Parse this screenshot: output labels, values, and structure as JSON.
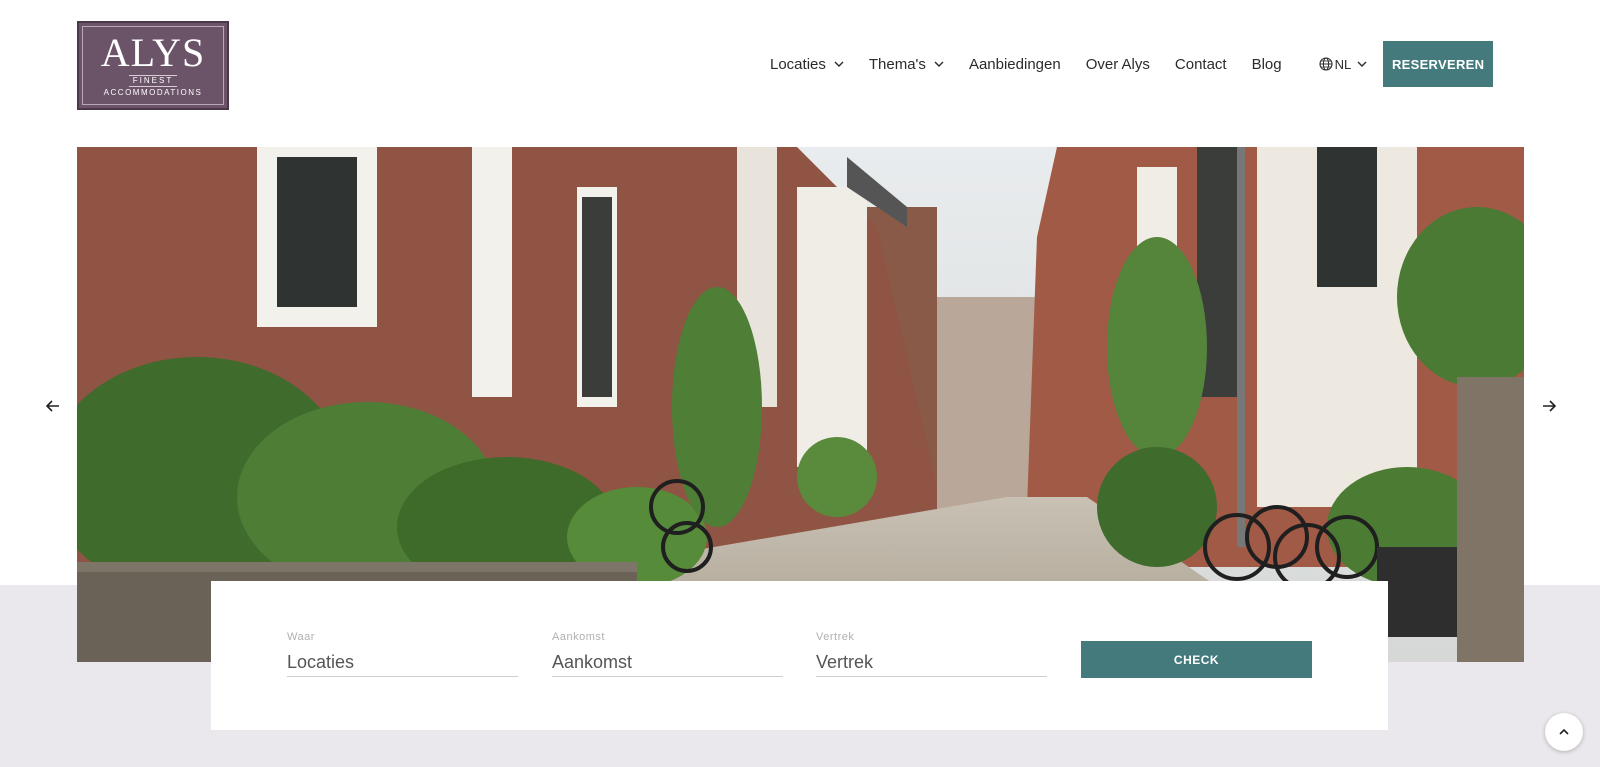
{
  "brand": {
    "name": "ALYS",
    "tagline_1": "FINEST",
    "tagline_2": "ACCOMMODATIONS",
    "color": "#6b5468"
  },
  "nav": {
    "items": [
      {
        "label": "Locaties",
        "has_dropdown": true
      },
      {
        "label": "Thema's",
        "has_dropdown": true
      },
      {
        "label": "Aanbiedingen",
        "has_dropdown": false
      },
      {
        "label": "Over Alys",
        "has_dropdown": false
      },
      {
        "label": "Contact",
        "has_dropdown": false
      },
      {
        "label": "Blog",
        "has_dropdown": false
      }
    ],
    "language": "NL",
    "reserve_label": "RESERVEREN"
  },
  "hero": {
    "image": "Street photo: narrow cobblestone alley between brick houses with plants and bicycles",
    "prev_icon": "arrow-left-icon",
    "next_icon": "arrow-right-icon"
  },
  "search": {
    "where": {
      "label": "Waar",
      "value": "Locaties"
    },
    "arrival": {
      "label": "Aankomst",
      "value": "Aankomst"
    },
    "departure": {
      "label": "Vertrek",
      "value": "Vertrek"
    },
    "submit_label": "CHECK"
  },
  "colors": {
    "accent": "#457a7d",
    "band": "#eae8ec"
  },
  "scroll_top_icon": "chevron-up-icon"
}
